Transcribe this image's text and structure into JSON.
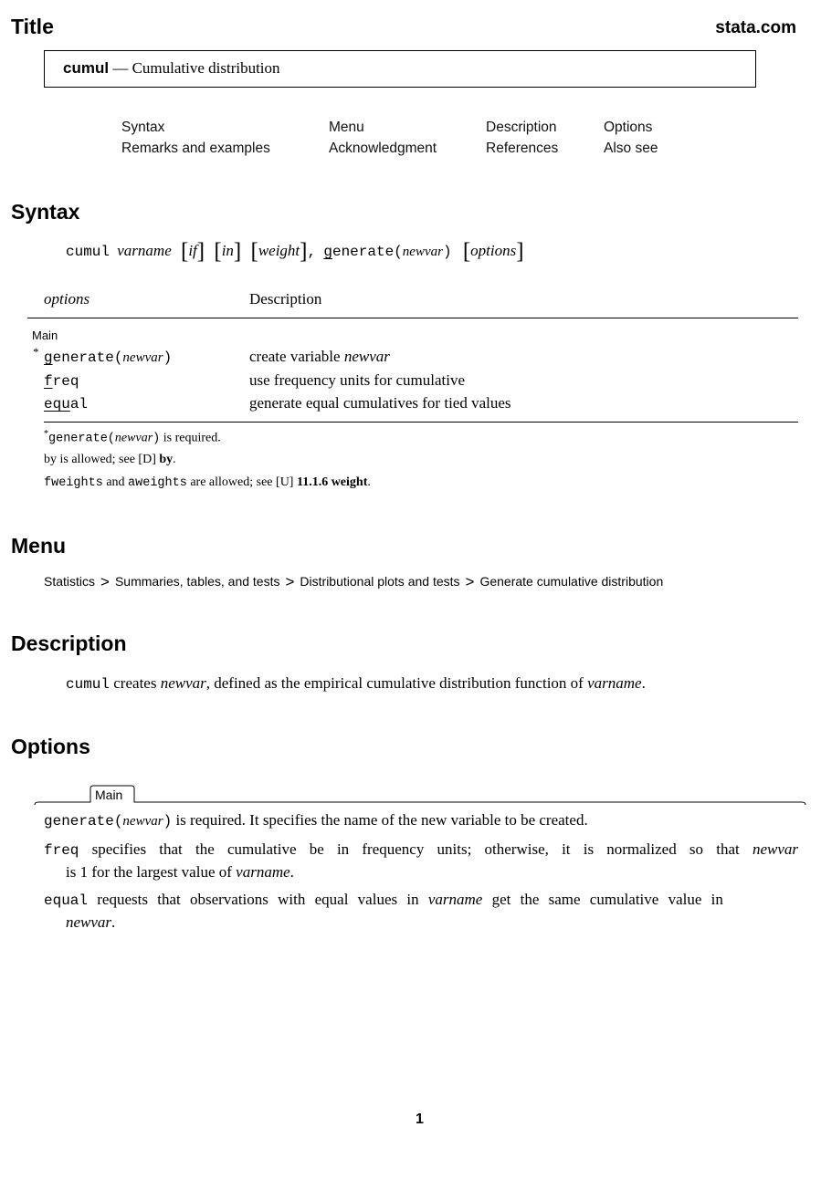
{
  "header": {
    "section_title": "Title",
    "brand": "stata.com",
    "command": "cumul",
    "dash": "—",
    "command_desc": "Cumulative distribution"
  },
  "toc": {
    "items": [
      "Syntax",
      "Menu",
      "Description",
      "Options",
      "Remarks and examples",
      "Acknowledgment",
      "References",
      "Also see"
    ]
  },
  "syntax": {
    "heading": "Syntax",
    "cmd": "cumul",
    "varname": "varname",
    "if": "if",
    "in": "in",
    "weight": "weight",
    "comma": ",",
    "gen_u": "g",
    "gen_rest": "enerate(",
    "newvar": "newvar",
    "close_paren": ")",
    "options": "options",
    "lbracket": "[",
    "rbracket": "]",
    "table": {
      "col_options": "options",
      "col_description": "Description",
      "group": "Main",
      "rows": [
        {
          "star": "*",
          "u": "g",
          "rest": "enerate(",
          "arg": "newvar",
          "close": ")",
          "desc": "create variable ",
          "desc_it": "newvar"
        },
        {
          "star": "",
          "u": "f",
          "rest": "req",
          "arg": "",
          "close": "",
          "desc": "use frequency units for cumulative",
          "desc_it": ""
        },
        {
          "star": "",
          "u": "equ",
          "rest": "al",
          "arg": "",
          "close": "",
          "desc": "generate equal cumulatives for tied values",
          "desc_it": ""
        }
      ]
    },
    "notes": {
      "n1_star": "*",
      "n1_cmd": "generate(",
      "n1_arg": "newvar",
      "n1_close": ")",
      "n1_rest": " is required.",
      "n2_a": "by",
      "n2_b": " is allowed; see ",
      "n2_ref": "[D]",
      "n2_link": " by",
      "n2_end": ".",
      "n3_a": "fweights",
      "n3_b": " and ",
      "n3_c": "aweights",
      "n3_d": " are allowed; see ",
      "n3_ref": "[U]",
      "n3_link": " 11.1.6 weight",
      "n3_end": "."
    }
  },
  "menu": {
    "heading": "Menu",
    "path": [
      "Statistics",
      "Summaries, tables, and tests",
      "Distributional plots and tests",
      "Generate cumulative distribution"
    ],
    "separator": ">"
  },
  "description": {
    "heading": "Description",
    "cmd": "cumul",
    "t1": " creates ",
    "newvar": "newvar",
    "t2": ", defined as the empirical cumulative distribution function of ",
    "varname": "varname",
    "t3": "."
  },
  "options": {
    "heading": "Options",
    "tab": "Main",
    "p1": {
      "cmd": "generate(",
      "arg": "newvar",
      "close": ")",
      "text": " is required. It specifies the name of the new variable to be created."
    },
    "p2": {
      "cmd": "freq",
      "text": " specifies that the cumulative be in frequency units; otherwise, it is normalized so that ",
      "it1": "newvar",
      "line2a": "is 1 for the largest value of ",
      "it2": "varname",
      "line2b": "."
    },
    "p3": {
      "cmd": "equal",
      "text": " requests that observations with equal values in ",
      "it1": "varname",
      "text2": " get the same cumulative value in",
      "it2": "newvar",
      "end": "."
    }
  },
  "footer": {
    "page_number": "1"
  }
}
